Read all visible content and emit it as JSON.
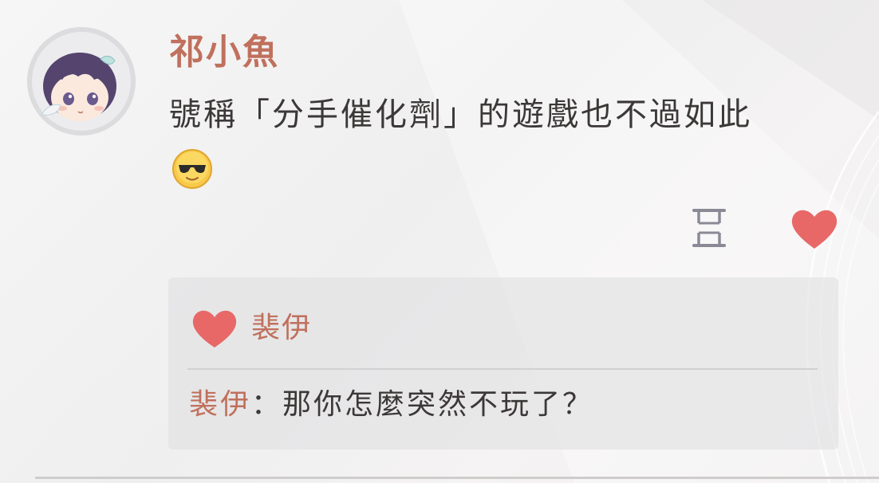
{
  "post": {
    "author": "祁小魚",
    "text": "號稱「分手催化劑」的遊戲也不過如此",
    "emoji": "sunglasses-emoji"
  },
  "actions": {
    "history_icon": "hourglass-icon",
    "like_icon": "heart-icon"
  },
  "likes": {
    "icon": "heart-icon",
    "names": "裴伊"
  },
  "comments": [
    {
      "author": "裴伊",
      "separator": "：",
      "text": "那你怎麼突然不玩了？"
    }
  ],
  "colors": {
    "name": "#c0705c",
    "heart": "#e86868",
    "text": "#3c3838",
    "panel": "#e4e4e6",
    "icon": "#8a8a96"
  }
}
